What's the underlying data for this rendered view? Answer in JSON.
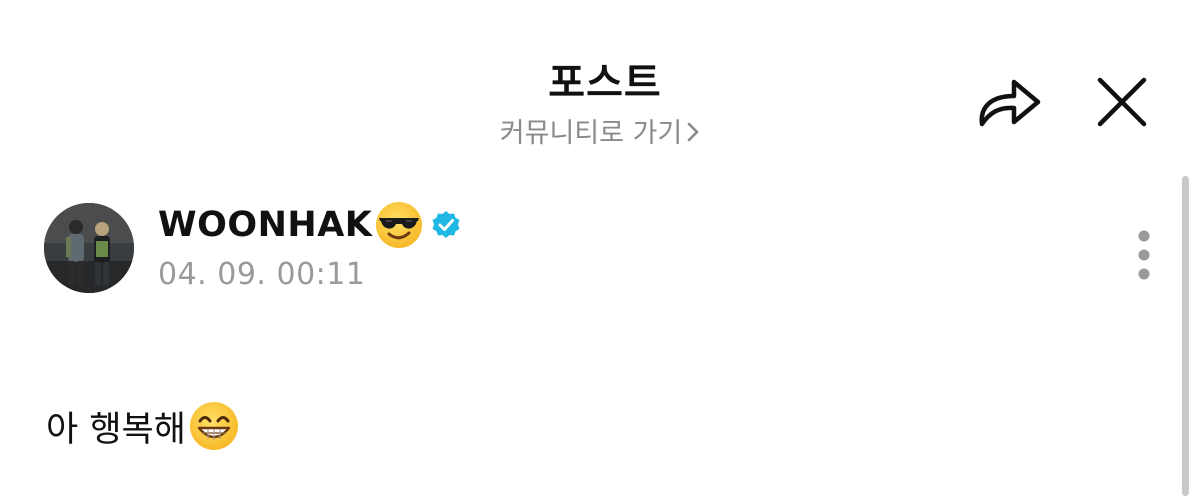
{
  "header": {
    "title": "포스트",
    "community_link": "커뮤니티로 가기",
    "share_icon": "share-arrow-icon",
    "close_icon": "close-icon"
  },
  "post": {
    "author": "WOONHAK",
    "author_emoji": "smiling-face-with-sunglasses-emoji",
    "verified_icon": "verified-badge-icon",
    "timestamp": "04. 09. 00:11",
    "body_text": "아 행복해",
    "body_emoji": "beaming-face-emoji",
    "more_icon": "more-vertical-icon"
  },
  "colors": {
    "text": "#111111",
    "muted": "#8a8a8a",
    "verified": "#1fb8e4",
    "emoji_yellow": "#ffc83d"
  }
}
